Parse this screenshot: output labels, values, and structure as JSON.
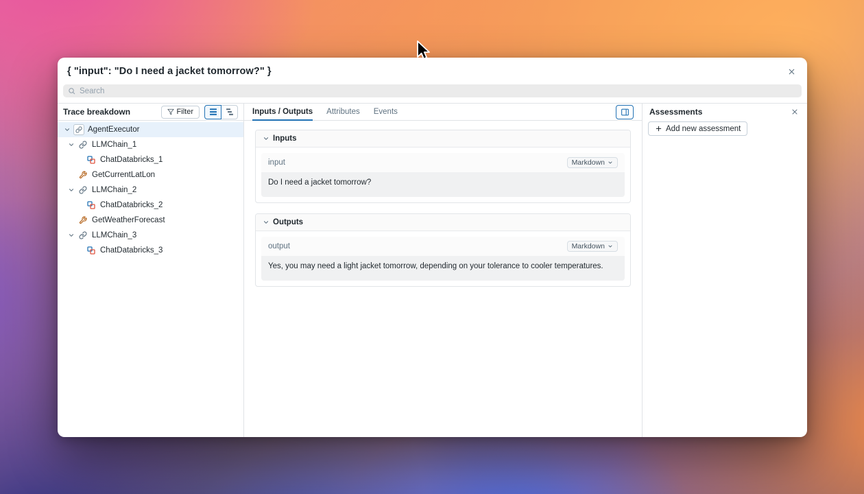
{
  "window": {
    "title": "{ \"input\": \"Do I need a jacket tomorrow?\" }"
  },
  "search": {
    "placeholder": "Search"
  },
  "sidebar": {
    "title": "Trace breakdown",
    "filter_label": "Filter",
    "tree": [
      {
        "label": "AgentExecutor",
        "icon": "chain",
        "level": 0,
        "expanded": true,
        "selected": true
      },
      {
        "label": "LLMChain_1",
        "icon": "chain",
        "level": 1,
        "expanded": true
      },
      {
        "label": "ChatDatabricks_1",
        "icon": "model",
        "level": 2
      },
      {
        "label": "GetCurrentLatLon",
        "icon": "tool",
        "level": 1
      },
      {
        "label": "LLMChain_2",
        "icon": "chain",
        "level": 1,
        "expanded": true
      },
      {
        "label": "ChatDatabricks_2",
        "icon": "model",
        "level": 2
      },
      {
        "label": "GetWeatherForecast",
        "icon": "tool",
        "level": 1
      },
      {
        "label": "LLMChain_3",
        "icon": "chain",
        "level": 1,
        "expanded": true
      },
      {
        "label": "ChatDatabricks_3",
        "icon": "model",
        "level": 2
      }
    ]
  },
  "main": {
    "tabs": [
      {
        "label": "Inputs / Outputs",
        "active": true
      },
      {
        "label": "Attributes",
        "active": false
      },
      {
        "label": "Events",
        "active": false
      }
    ],
    "inputs_section": {
      "title": "Inputs",
      "field_label": "input",
      "format": "Markdown",
      "value": "Do I need a jacket tomorrow?"
    },
    "outputs_section": {
      "title": "Outputs",
      "field_label": "output",
      "format": "Markdown",
      "value": "Yes, you may need a light jacket tomorrow, depending on your tolerance to cooler temperatures."
    }
  },
  "assessments": {
    "title": "Assessments",
    "add_button_label": "Add new assessment"
  },
  "colors": {
    "accent": "#2272b4",
    "selected_row": "#e7f1fb",
    "tool_icon": "#b05c10",
    "model_icon_primary": "#2272b4",
    "model_icon_secondary": "#e0533f"
  }
}
